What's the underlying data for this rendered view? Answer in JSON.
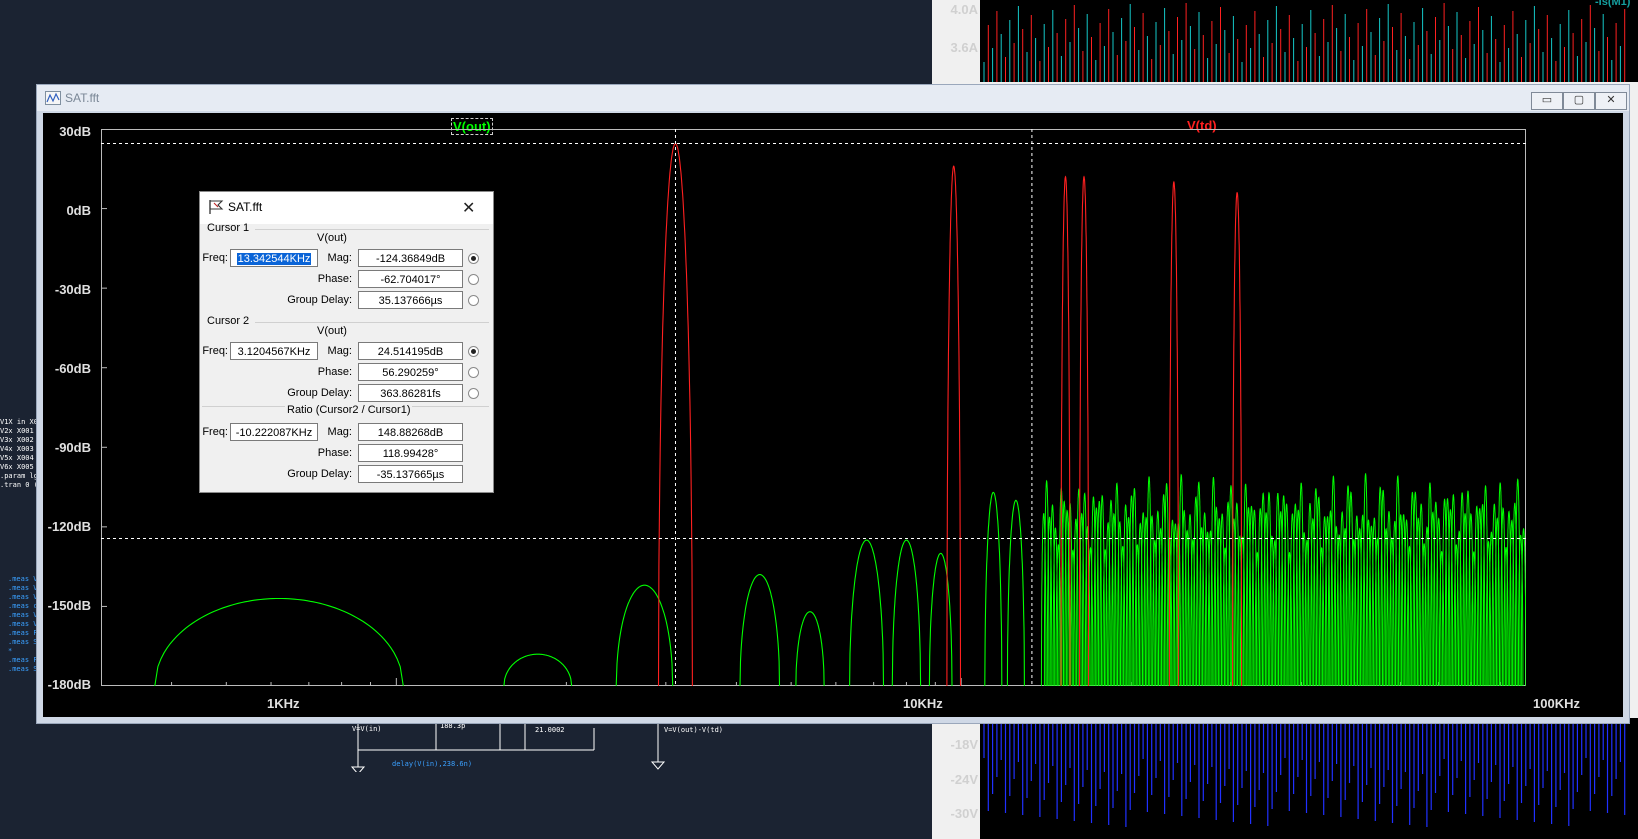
{
  "background": {
    "top_plot": {
      "title": "-Is(M1)",
      "y_ticks": [
        "4.0A",
        "3.6A"
      ]
    },
    "bottom_plot": {
      "y_ticks": [
        "-18V",
        "-24V",
        "-30V"
      ]
    },
    "schematic": {
      "left_lines": [
        "V1X in X0",
        "V2x X001",
        "V3x X002",
        "V4x X003",
        "V5x X004",
        "V6x X005",
        ".param lg",
        ".tran 0 (2"
      ],
      "meas_lines": [
        ".meas V",
        ".meas V",
        ".meas V",
        ".meas c",
        ".meas V",
        ".meas V",
        ".meas F",
        ".meas S",
        "*",
        ".meas F",
        ".meas S"
      ],
      "labels": [
        "V=V(in)",
        "188.3p",
        "21.0002",
        "V=V(out)-V(td)",
        "delay(V(in),238.6n)"
      ]
    }
  },
  "fft_window": {
    "title": "SAT.fft",
    "buttons": {
      "minimize": "▭",
      "maximize": "▢",
      "close": "✕"
    },
    "trace_labels": [
      {
        "text": "V(out)",
        "color": "#00ff00"
      },
      {
        "text": "V(td)",
        "color": "#ff2020"
      }
    ],
    "y_ticks": [
      "30dB",
      "0dB",
      "-30dB",
      "-60dB",
      "-90dB",
      "-120dB",
      "-150dB",
      "-180dB"
    ],
    "x_ticks": [
      "1KHz",
      "10KHz",
      "100KHz"
    ]
  },
  "chart_data": {
    "type": "line",
    "x_scale": "log",
    "xlim": [
      300,
      100000
    ],
    "ylim": [
      -180,
      30
    ],
    "x_ticks": [
      "1KHz",
      "10KHz",
      "100KHz"
    ],
    "y_ticks": [
      "30dB",
      "0dB",
      "-30dB",
      "-60dB",
      "-90dB",
      "-120dB",
      "-150dB",
      "-180dB"
    ],
    "grid": false,
    "series": [
      {
        "name": "V(out)",
        "color": "#00ff00",
        "peaks": [
          {
            "f": 620,
            "db": -147,
            "w": 0.22
          },
          {
            "f": 1780,
            "db": -168,
            "w": 0.06
          },
          {
            "f": 2750,
            "db": -142,
            "w": 0.05
          },
          {
            "f": 4400,
            "db": -138,
            "w": 0.035
          },
          {
            "f": 5400,
            "db": -152,
            "w": 0.025
          },
          {
            "f": 6800,
            "db": -125,
            "w": 0.03
          },
          {
            "f": 8000,
            "db": -125,
            "w": 0.025
          },
          {
            "f": 9200,
            "db": -130,
            "w": 0.02
          },
          {
            "f": 11400,
            "db": -107,
            "w": 0.015
          },
          {
            "f": 12500,
            "db": -110,
            "w": 0.015
          }
        ],
        "dense_region": {
          "from": 14000,
          "to": 100000,
          "db_low": -180,
          "db_high": -100
        }
      },
      {
        "name": "V(td)",
        "color": "#ff2020",
        "peaks": [
          {
            "f": 3120,
            "db": 24.5,
            "w": 0.03
          },
          {
            "f": 9700,
            "db": 16,
            "w": 0.012
          },
          {
            "f": 15300,
            "db": 12,
            "w": 0.008
          },
          {
            "f": 16500,
            "db": 12,
            "w": 0.008
          },
          {
            "f": 23800,
            "db": 10,
            "w": 0.008
          },
          {
            "f": 30800,
            "db": 6,
            "w": 0.008
          }
        ]
      }
    ],
    "cursors": [
      {
        "name": "Cursor 1",
        "freq_hz": 13342.544,
        "mag_db": -124.36849
      },
      {
        "name": "Cursor 2",
        "freq_hz": 3120.4567,
        "mag_db": 24.514195
      }
    ]
  },
  "cursor_dialog": {
    "title": "SAT.fft",
    "cursor1": {
      "label": "Cursor 1",
      "trace": "V(out)",
      "freq_label": "Freq:",
      "freq": "13.342544KHz",
      "mag_label": "Mag:",
      "mag": "-124.36849dB",
      "phase_label": "Phase:",
      "phase": "-62.704017°",
      "gd_label": "Group Delay:",
      "gd": "35.137666µs"
    },
    "cursor2": {
      "label": "Cursor 2",
      "trace": "V(out)",
      "freq_label": "Freq:",
      "freq": "3.1204567KHz",
      "mag_label": "Mag:",
      "mag": "24.514195dB",
      "phase_label": "Phase:",
      "phase": "56.290259°",
      "gd_label": "Group Delay:",
      "gd": "363.86281fs"
    },
    "ratio": {
      "label": "Ratio (Cursor2 / Cursor1)",
      "freq_label": "Freq:",
      "freq": "-10.222087KHz",
      "mag_label": "Mag:",
      "mag": "148.88268dB",
      "phase_label": "Phase:",
      "phase": "118.99428°",
      "gd_label": "Group Delay:",
      "gd": "-35.137665µs"
    }
  }
}
